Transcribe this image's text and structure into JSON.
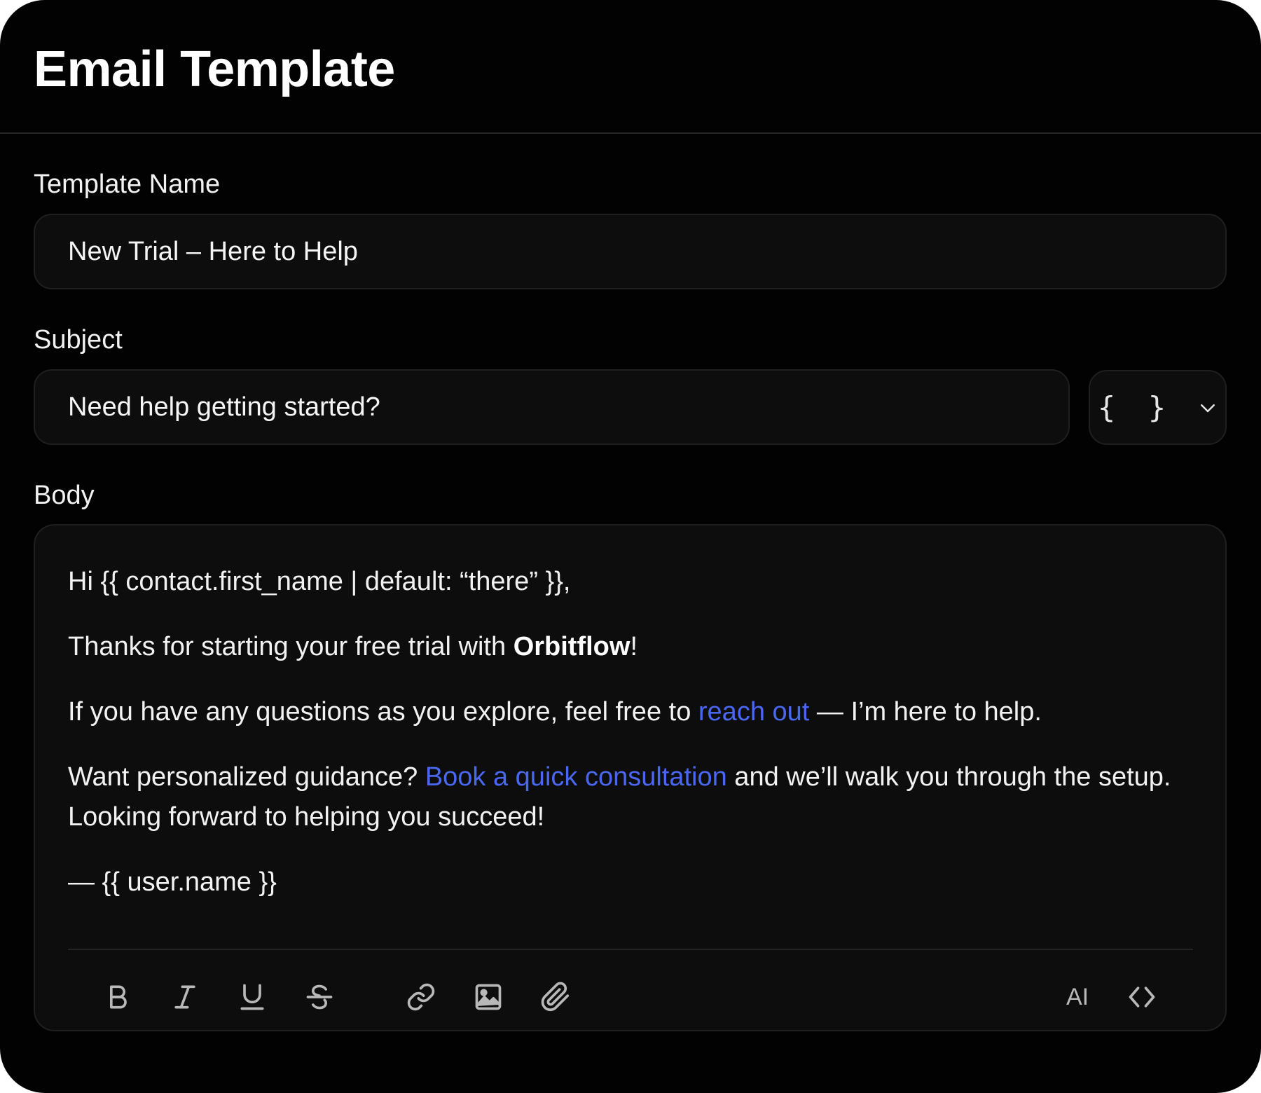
{
  "header": {
    "title": "Email Template"
  },
  "template_name": {
    "label": "Template Name",
    "value": "New Trial – Here to Help"
  },
  "subject": {
    "label": "Subject",
    "value": "Need help getting started?",
    "variable_button": "{ }"
  },
  "body": {
    "label": "Body",
    "greeting": "Hi {{ contact.first_name | default: “there” }},",
    "p1_text": "Thanks for starting your free trial with ",
    "p1_bold": "Orbitflow",
    "p1_end": "!",
    "p2_text": "If you have any questions as you explore, feel free to ",
    "p2_link": "reach out",
    "p2_end": " — I’m here to help.",
    "p3_text": "Want personalized guidance? ",
    "p3_link": "Book a quick consultation",
    "p3_end": " and we’ll walk you through the setup. Looking forward to helping you succeed!",
    "signature": "— {{ user.name }}"
  },
  "toolbar": {
    "ai_label": "AI",
    "icons": [
      "bold-icon",
      "italic-icon",
      "underline-icon",
      "strikethrough-icon",
      "link-icon",
      "image-icon",
      "attachment-icon",
      "code-icon"
    ]
  },
  "colors": {
    "background": "#020202",
    "field": "#0d0d0d",
    "link": "#4a67f0"
  }
}
